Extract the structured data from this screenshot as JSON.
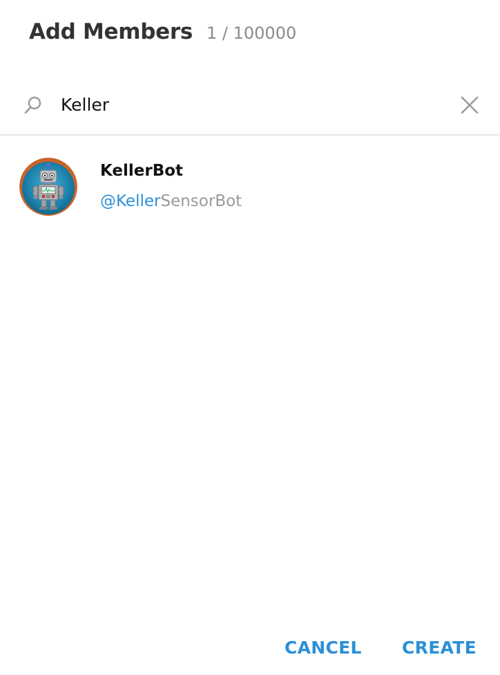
{
  "header": {
    "title": "Add Members",
    "counter": "1 / 100000"
  },
  "search": {
    "value": "Keller",
    "icon": "search-icon",
    "clear_icon": "close-icon"
  },
  "results": [
    {
      "name": "KellerBot",
      "handle_match": "@Keller",
      "handle_rest": "SensorBot",
      "avatar": "robot-avatar"
    }
  ],
  "footer": {
    "cancel_label": "CANCEL",
    "create_label": "CREATE"
  },
  "colors": {
    "accent": "#2b8fd8",
    "muted": "#9a9a9a",
    "divider": "#e7e7e7"
  }
}
